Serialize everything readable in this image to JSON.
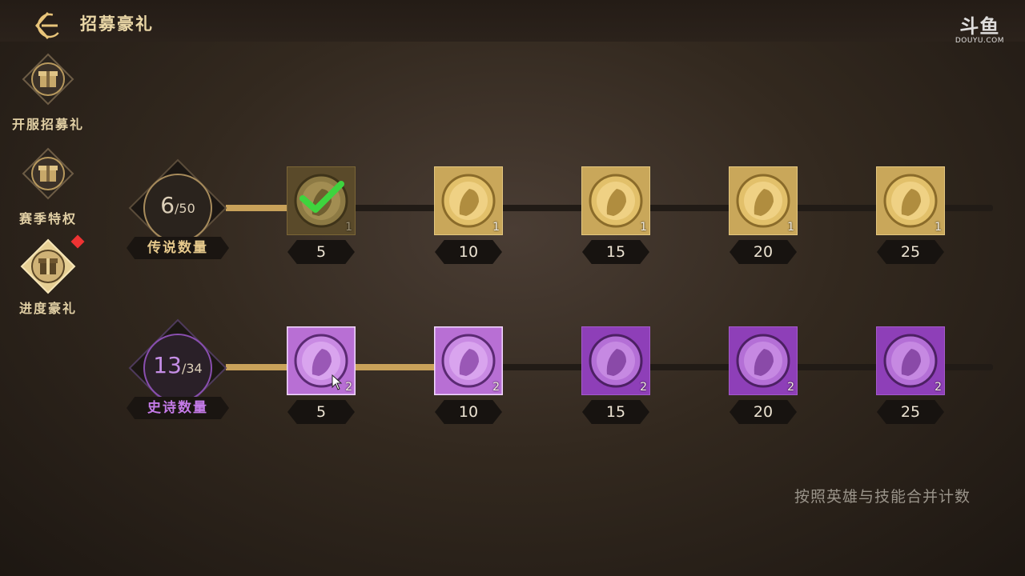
{
  "header": {
    "title": "招募豪礼",
    "watermark_main": "斗鱼",
    "watermark_sub": "DOUYU.COM"
  },
  "sidebar": {
    "items": [
      {
        "label": "开服招募礼",
        "icon": "gift-box-icon",
        "active": false
      },
      {
        "label": "赛季特权",
        "icon": "gift-box-icon",
        "active": false
      },
      {
        "label": "进度豪礼",
        "icon": "gift-box-icon",
        "active": true,
        "has_notification": true
      }
    ]
  },
  "rows": [
    {
      "name": "legendary",
      "label": "传说数量",
      "current": "6",
      "total": "/50",
      "progress_fraction": 0.06,
      "accent": "#c9a25a",
      "rewards": [
        {
          "tier": "5",
          "qty": "1",
          "claimed": true
        },
        {
          "tier": "10",
          "qty": "1",
          "claimed": false
        },
        {
          "tier": "15",
          "qty": "1",
          "claimed": false
        },
        {
          "tier": "20",
          "qty": "1",
          "claimed": false
        },
        {
          "tier": "25",
          "qty": "1",
          "claimed": false
        }
      ]
    },
    {
      "name": "epic",
      "label": "史诗数量",
      "current": "13",
      "total": "/34",
      "progress_fraction": 0.26,
      "accent": "#a04bc9",
      "rewards": [
        {
          "tier": "5",
          "qty": "2",
          "claimable": true
        },
        {
          "tier": "10",
          "qty": "2",
          "claimable": true
        },
        {
          "tier": "15",
          "qty": "2",
          "claimable": false
        },
        {
          "tier": "20",
          "qty": "2",
          "claimable": false
        },
        {
          "tier": "25",
          "qty": "2",
          "claimable": false
        }
      ]
    }
  ],
  "footer_note": "按照英雄与技能合并计数",
  "colors": {
    "gold": "#c9a25a",
    "purple": "#8e3fb8",
    "claimed_check": "#3ed43e",
    "notification": "#e33333"
  }
}
